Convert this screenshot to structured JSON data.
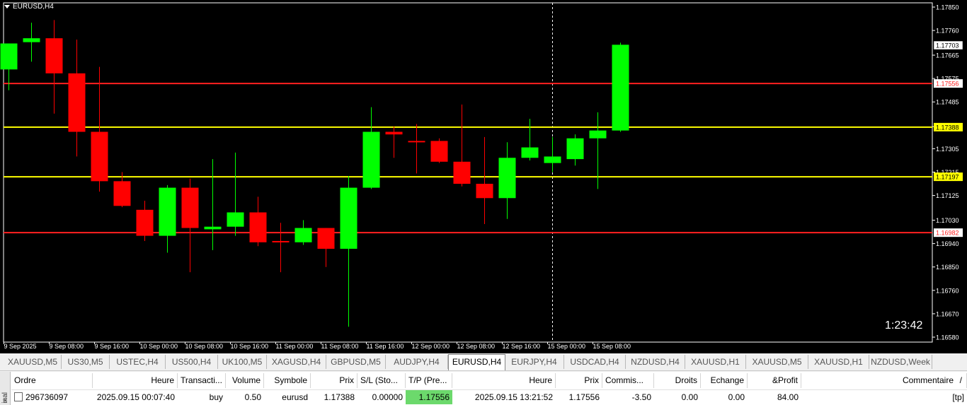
{
  "chart": {
    "title": "EURUSD,H4",
    "timer": "1:23:42"
  },
  "chart_data": {
    "type": "candlestick",
    "ylim": [
      1.1658,
      1.1785
    ],
    "price_ticks": [
      "1.17850",
      "1.17760",
      "1.17665",
      "1.17575",
      "1.17485",
      "1.17390",
      "1.17305",
      "1.17215",
      "1.17125",
      "1.17030",
      "1.16940",
      "1.16850",
      "1.16760",
      "1.16670",
      "1.16580"
    ],
    "time_labels": [
      "9 Sep 2025",
      "9 Sep 08:00",
      "9 Sep 16:00",
      "10 Sep 00:00",
      "10 Sep 08:00",
      "10 Sep 16:00",
      "11 Sep 00:00",
      "11 Sep 08:00",
      "11 Sep 16:00",
      "12 Sep 00:00",
      "12 Sep 08:00",
      "12 Sep 16:00",
      "15 Sep 00:00",
      "15 Sep 08:00"
    ],
    "time_label_every": 2,
    "hlines": [
      {
        "price": 1.17556,
        "label": "1.17556",
        "color": "#ff2020",
        "label_text_color": "#ff2020",
        "label_bg": "#ffffff"
      },
      {
        "price": 1.17388,
        "label": "1.17388",
        "color": "#ffff00",
        "label_text_color": "#000000",
        "label_bg": "#ffff00"
      },
      {
        "price": 1.17197,
        "label": "1.17197",
        "color": "#ffff00",
        "label_text_color": "#000000",
        "label_bg": "#ffff00"
      },
      {
        "price": 1.16982,
        "label": "1.16982",
        "color": "#ff2020",
        "label_text_color": "#ff2020",
        "label_bg": "#ffffff"
      }
    ],
    "current_price": {
      "price": 1.17703,
      "label": "1.17703"
    },
    "crosshair_index": 24,
    "bull_color": "#00ff00",
    "bear_color": "#ff0000",
    "candles": [
      {
        "o": 1.1761,
        "h": 1.1771,
        "l": 1.1753,
        "c": 1.1771
      },
      {
        "o": 1.17715,
        "h": 1.1779,
        "l": 1.1764,
        "c": 1.1773
      },
      {
        "o": 1.1773,
        "h": 1.178,
        "l": 1.1744,
        "c": 1.17595
      },
      {
        "o": 1.17595,
        "h": 1.17725,
        "l": 1.17275,
        "c": 1.1737
      },
      {
        "o": 1.1737,
        "h": 1.1762,
        "l": 1.1714,
        "c": 1.1718
      },
      {
        "o": 1.1718,
        "h": 1.17215,
        "l": 1.1708,
        "c": 1.17085
      },
      {
        "o": 1.1707,
        "h": 1.17105,
        "l": 1.1695,
        "c": 1.1697
      },
      {
        "o": 1.1697,
        "h": 1.17165,
        "l": 1.16905,
        "c": 1.17155
      },
      {
        "o": 1.17155,
        "h": 1.1719,
        "l": 1.1683,
        "c": 1.17
      },
      {
        "o": 1.16995,
        "h": 1.17265,
        "l": 1.16915,
        "c": 1.17005
      },
      {
        "o": 1.17005,
        "h": 1.1729,
        "l": 1.1697,
        "c": 1.1706
      },
      {
        "o": 1.1706,
        "h": 1.1712,
        "l": 1.1693,
        "c": 1.16945
      },
      {
        "o": 1.1695,
        "h": 1.1702,
        "l": 1.1683,
        "c": 1.16945
      },
      {
        "o": 1.16945,
        "h": 1.1703,
        "l": 1.16935,
        "c": 1.17
      },
      {
        "o": 1.17,
        "h": 1.17,
        "l": 1.1685,
        "c": 1.1692
      },
      {
        "o": 1.1692,
        "h": 1.172,
        "l": 1.1662,
        "c": 1.17155
      },
      {
        "o": 1.17155,
        "h": 1.17465,
        "l": 1.1715,
        "c": 1.1737
      },
      {
        "o": 1.1737,
        "h": 1.1739,
        "l": 1.1727,
        "c": 1.1736
      },
      {
        "o": 1.17335,
        "h": 1.174,
        "l": 1.1721,
        "c": 1.1733
      },
      {
        "o": 1.17335,
        "h": 1.17345,
        "l": 1.1725,
        "c": 1.17255
      },
      {
        "o": 1.17255,
        "h": 1.17475,
        "l": 1.1716,
        "c": 1.1717
      },
      {
        "o": 1.1717,
        "h": 1.1735,
        "l": 1.17015,
        "c": 1.17115
      },
      {
        "o": 1.17115,
        "h": 1.1733,
        "l": 1.17035,
        "c": 1.1727
      },
      {
        "o": 1.1727,
        "h": 1.1742,
        "l": 1.1726,
        "c": 1.1731
      },
      {
        "o": 1.1725,
        "h": 1.1735,
        "l": 1.17215,
        "c": 1.17275
      },
      {
        "o": 1.17265,
        "h": 1.1736,
        "l": 1.1724,
        "c": 1.17345
      },
      {
        "o": 1.17345,
        "h": 1.17445,
        "l": 1.1715,
        "c": 1.17375
      },
      {
        "o": 1.17375,
        "h": 1.17713,
        "l": 1.1737,
        "c": 1.17705
      }
    ]
  },
  "tabs": [
    {
      "label": "XAUUSD,M5",
      "active": false
    },
    {
      "label": "US30,M5",
      "active": false
    },
    {
      "label": "USTEC,H4",
      "active": false
    },
    {
      "label": "US500,H4",
      "active": false
    },
    {
      "label": "UK100,M5",
      "active": false
    },
    {
      "label": "XAGUSD,H4",
      "active": false
    },
    {
      "label": "GBPUSD,M5",
      "active": false
    },
    {
      "label": "AUDJPY,H4",
      "active": false
    },
    {
      "label": "EURUSD,H4",
      "active": true
    },
    {
      "label": "EURJPY,H4",
      "active": false
    },
    {
      "label": "USDCAD,H4",
      "active": false
    },
    {
      "label": "NZDUSD,H4",
      "active": false
    },
    {
      "label": "XAUUSD,H1",
      "active": false
    },
    {
      "label": "XAUUSD,M5",
      "active": false
    },
    {
      "label": "XAUUSD,H1",
      "active": false
    },
    {
      "label": "NZDUSD,Week",
      "active": false
    }
  ],
  "terminal": {
    "side_label": "inal",
    "close_glyph": "×",
    "columns": [
      "Ordre",
      "Heure",
      "Transacti...",
      "Volume",
      "Symbole",
      "Prix",
      "S/L (Sto...",
      "T/P (Pre...",
      "Heure",
      "Prix",
      "Commis...",
      "Droits",
      "Echange",
      "&Profit",
      "Commentaire"
    ],
    "sort_glyph": "/",
    "row": {
      "order": "296736097",
      "open_time": "2025.09.15 00:07:40",
      "type": "buy",
      "volume": "0.50",
      "symbol": "eurusd",
      "open_price": "1.17388",
      "sl": "0.00000",
      "tp": "1.17556",
      "close_time": "2025.09.15 13:21:52",
      "close_price": "1.17556",
      "commission": "-3.50",
      "swap": "0.00",
      "exchange": "0.00",
      "profit": "84.00",
      "comment": "[tp]"
    }
  }
}
